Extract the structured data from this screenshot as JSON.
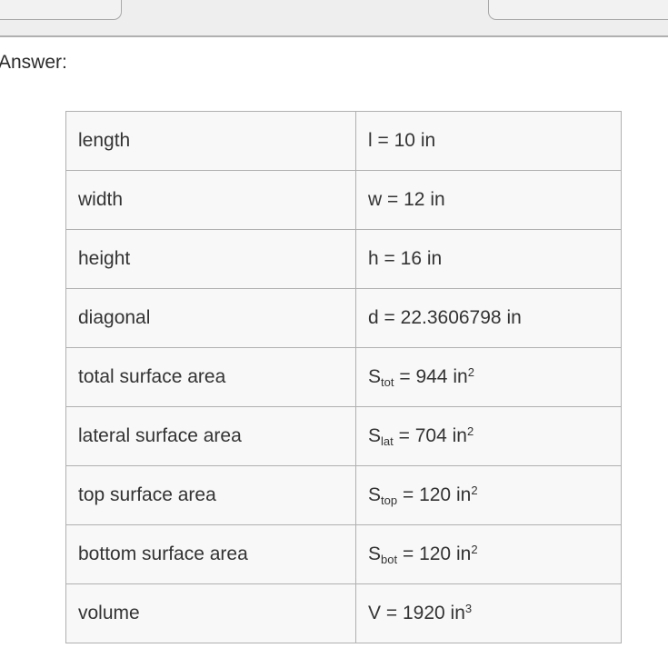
{
  "toolbar": {
    "left_tab_label": "",
    "right_tab_label": ""
  },
  "answer_label": "Answer:",
  "table": {
    "rows": [
      {
        "label": "length",
        "symbol": "l",
        "sub": "",
        "equals": "=",
        "value": "10",
        "unit": "in",
        "exponent": "",
        "value_text": "l = 10 in"
      },
      {
        "label": "width",
        "symbol": "w",
        "sub": "",
        "equals": "=",
        "value": "12",
        "unit": "in",
        "exponent": "",
        "value_text": "w = 12 in"
      },
      {
        "label": "height",
        "symbol": "h",
        "sub": "",
        "equals": "=",
        "value": "16",
        "unit": "in",
        "exponent": "",
        "value_text": "h = 16 in"
      },
      {
        "label": "diagonal",
        "symbol": "d",
        "sub": "",
        "equals": "=",
        "value": "22.3606798",
        "unit": "in",
        "exponent": "",
        "value_text": "d = 22.3606798 in"
      },
      {
        "label": "total surface area",
        "symbol": "S",
        "sub": "tot",
        "equals": "=",
        "value": "944",
        "unit": "in",
        "exponent": "2",
        "value_text": "S_tot = 944 in^2"
      },
      {
        "label": "lateral surface area",
        "symbol": "S",
        "sub": "lat",
        "equals": "=",
        "value": "704",
        "unit": "in",
        "exponent": "2",
        "value_text": "S_lat = 704 in^2"
      },
      {
        "label": "top surface area",
        "symbol": "S",
        "sub": "top",
        "equals": "=",
        "value": "120",
        "unit": "in",
        "exponent": "2",
        "value_text": "S_top = 120 in^2"
      },
      {
        "label": "bottom surface area",
        "symbol": "S",
        "sub": "bot",
        "equals": "=",
        "value": "120",
        "unit": "in",
        "exponent": "2",
        "value_text": "S_bot = 120 in^2"
      },
      {
        "label": "volume",
        "symbol": "V",
        "sub": "",
        "equals": "=",
        "value": "1920",
        "unit": "in",
        "exponent": "3",
        "value_text": "V = 1920 in^3"
      }
    ]
  },
  "colors": {
    "toolbar_background": "#eeeeee",
    "toolbar_border": "#b0b0b0",
    "tab_background": "#f2f2f2",
    "cell_background": "#f8f8f8",
    "cell_border": "#b0b0b0",
    "text": "#333333",
    "page_background": "#ffffff"
  }
}
